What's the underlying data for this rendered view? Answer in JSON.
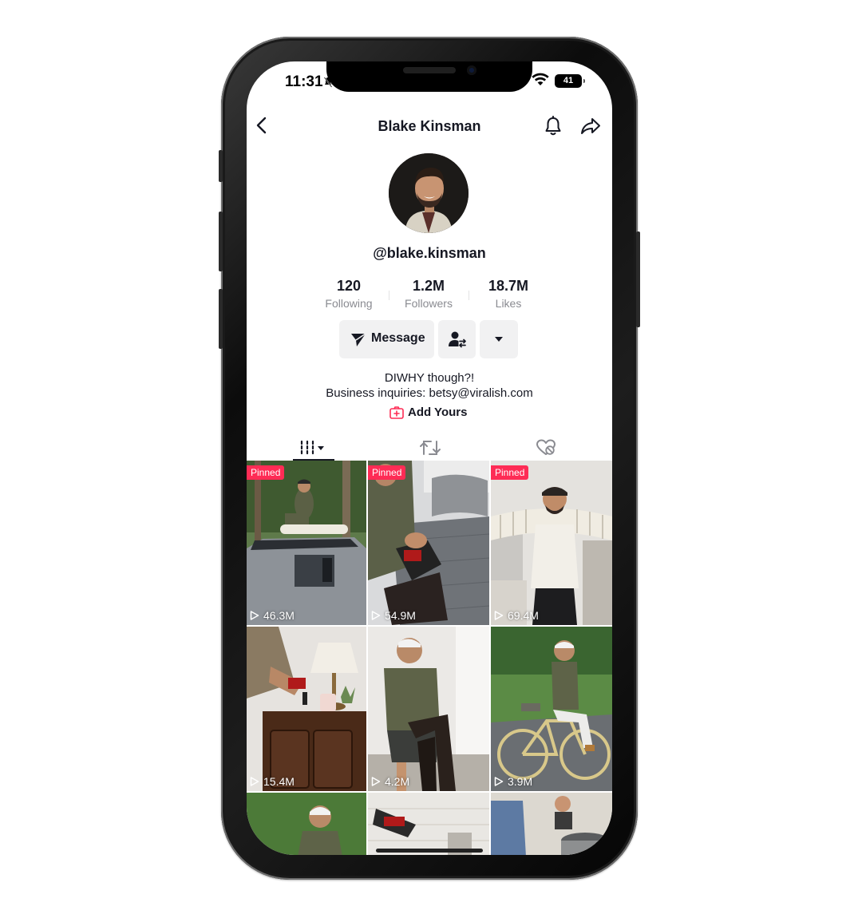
{
  "status_bar": {
    "time": "11:31",
    "battery": "41"
  },
  "header": {
    "title": "Blake Kinsman"
  },
  "profile": {
    "handle": "@blake.kinsman",
    "stats": [
      {
        "value": "120",
        "label": "Following"
      },
      {
        "value": "1.2M",
        "label": "Followers"
      },
      {
        "value": "18.7M",
        "label": "Likes"
      }
    ],
    "message_label": "Message",
    "bio_line1": "DIWHY though?!",
    "bio_line2": "Business inquiries: betsy@viralish.com",
    "add_yours_label": "Add Yours"
  },
  "videos": [
    {
      "pinned": "Pinned",
      "views": "46.3M"
    },
    {
      "pinned": "Pinned",
      "views": "54.9M"
    },
    {
      "pinned": "Pinned",
      "views": "69.4M"
    },
    {
      "views": "15.4M"
    },
    {
      "views": "4.2M"
    },
    {
      "views": "3.9M"
    }
  ],
  "colors": {
    "accent": "#fe2c55",
    "text": "#161823",
    "muted": "#8a8b91",
    "pill": "#f1f1f2"
  }
}
